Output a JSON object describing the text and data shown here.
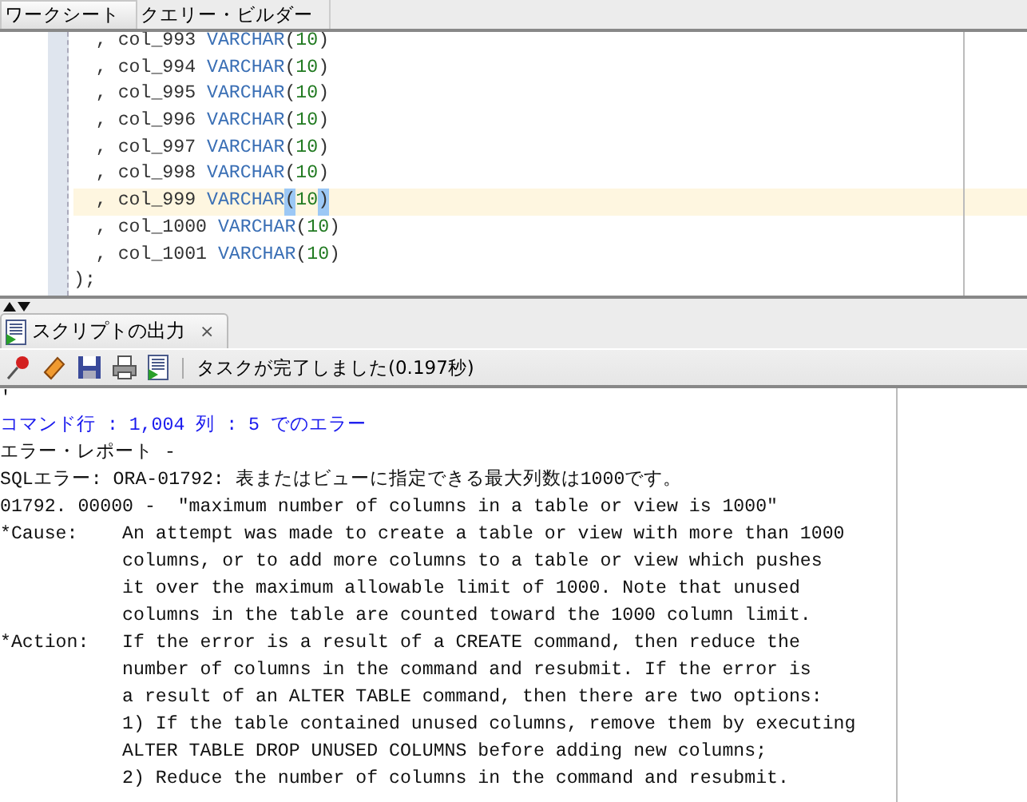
{
  "tabs": [
    {
      "label": "ワークシート",
      "selected": true
    },
    {
      "label": "クエリー・ビルダー",
      "selected": false
    }
  ],
  "editor": {
    "lines": [
      {
        "current": false,
        "parts": [
          {
            "kind": "plain",
            "text": "  , col_993 "
          },
          {
            "kind": "keyword",
            "text": "VARCHAR"
          },
          {
            "kind": "plain",
            "text": "("
          },
          {
            "kind": "number",
            "text": "10"
          },
          {
            "kind": "plain",
            "text": ")"
          }
        ]
      },
      {
        "current": false,
        "parts": [
          {
            "kind": "plain",
            "text": "  , col_994 "
          },
          {
            "kind": "keyword",
            "text": "VARCHAR"
          },
          {
            "kind": "plain",
            "text": "("
          },
          {
            "kind": "number",
            "text": "10"
          },
          {
            "kind": "plain",
            "text": ")"
          }
        ]
      },
      {
        "current": false,
        "parts": [
          {
            "kind": "plain",
            "text": "  , col_995 "
          },
          {
            "kind": "keyword",
            "text": "VARCHAR"
          },
          {
            "kind": "plain",
            "text": "("
          },
          {
            "kind": "number",
            "text": "10"
          },
          {
            "kind": "plain",
            "text": ")"
          }
        ]
      },
      {
        "current": false,
        "parts": [
          {
            "kind": "plain",
            "text": "  , col_996 "
          },
          {
            "kind": "keyword",
            "text": "VARCHAR"
          },
          {
            "kind": "plain",
            "text": "("
          },
          {
            "kind": "number",
            "text": "10"
          },
          {
            "kind": "plain",
            "text": ")"
          }
        ]
      },
      {
        "current": false,
        "parts": [
          {
            "kind": "plain",
            "text": "  , col_997 "
          },
          {
            "kind": "keyword",
            "text": "VARCHAR"
          },
          {
            "kind": "plain",
            "text": "("
          },
          {
            "kind": "number",
            "text": "10"
          },
          {
            "kind": "plain",
            "text": ")"
          }
        ]
      },
      {
        "current": false,
        "parts": [
          {
            "kind": "plain",
            "text": "  , col_998 "
          },
          {
            "kind": "keyword",
            "text": "VARCHAR"
          },
          {
            "kind": "plain",
            "text": "("
          },
          {
            "kind": "number",
            "text": "10"
          },
          {
            "kind": "plain",
            "text": ")"
          }
        ]
      },
      {
        "current": true,
        "parts": [
          {
            "kind": "plain",
            "text": "  , col_999 "
          },
          {
            "kind": "keyword",
            "text": "VARCHAR"
          },
          {
            "kind": "match",
            "text": "("
          },
          {
            "kind": "number",
            "text": "10"
          },
          {
            "kind": "match",
            "text": ")"
          }
        ]
      },
      {
        "current": false,
        "parts": [
          {
            "kind": "plain",
            "text": "  , col_1000 "
          },
          {
            "kind": "keyword",
            "text": "VARCHAR"
          },
          {
            "kind": "plain",
            "text": "("
          },
          {
            "kind": "number",
            "text": "10"
          },
          {
            "kind": "plain",
            "text": ")"
          }
        ]
      },
      {
        "current": false,
        "parts": [
          {
            "kind": "plain",
            "text": "  , col_1001 "
          },
          {
            "kind": "keyword",
            "text": "VARCHAR"
          },
          {
            "kind": "plain",
            "text": "("
          },
          {
            "kind": "number",
            "text": "10"
          },
          {
            "kind": "plain",
            "text": ")"
          }
        ]
      },
      {
        "current": false,
        "parts": [
          {
            "kind": "plain",
            "text": ");"
          }
        ]
      }
    ]
  },
  "output": {
    "tab": {
      "label": "スクリプトの出力",
      "close": "×",
      "selected": true
    },
    "status": "タスクが完了しました(0.197秒)",
    "lines": [
      {
        "kind": "plain",
        "text": "'"
      },
      {
        "kind": "location",
        "text": "コマンド行 : 1,004 列 : 5 でのエラー"
      },
      {
        "kind": "plain",
        "text": "エラー・レポート -"
      },
      {
        "kind": "plain",
        "text": "SQLエラー: ORA-01792: 表またはビューに指定できる最大列数は1000です。"
      },
      {
        "kind": "plain",
        "text": "01792. 00000 -  \"maximum number of columns in a table or view is 1000\""
      },
      {
        "kind": "plain",
        "text": "*Cause:    An attempt was made to create a table or view with more than 1000"
      },
      {
        "kind": "plain",
        "text": "           columns, or to add more columns to a table or view which pushes"
      },
      {
        "kind": "plain",
        "text": "           it over the maximum allowable limit of 1000. Note that unused"
      },
      {
        "kind": "plain",
        "text": "           columns in the table are counted toward the 1000 column limit."
      },
      {
        "kind": "plain",
        "text": "*Action:   If the error is a result of a CREATE command, then reduce the"
      },
      {
        "kind": "plain",
        "text": "           number of columns in the command and resubmit. If the error is"
      },
      {
        "kind": "plain",
        "text": "           a result of an ALTER TABLE command, then there are two options:"
      },
      {
        "kind": "plain",
        "text": "           1) If the table contained unused columns, remove them by executing"
      },
      {
        "kind": "plain",
        "text": "           ALTER TABLE DROP UNUSED COLUMNS before adding new columns;"
      },
      {
        "kind": "plain",
        "text": "           2) Reduce the number of columns in the command and resubmit."
      }
    ]
  }
}
